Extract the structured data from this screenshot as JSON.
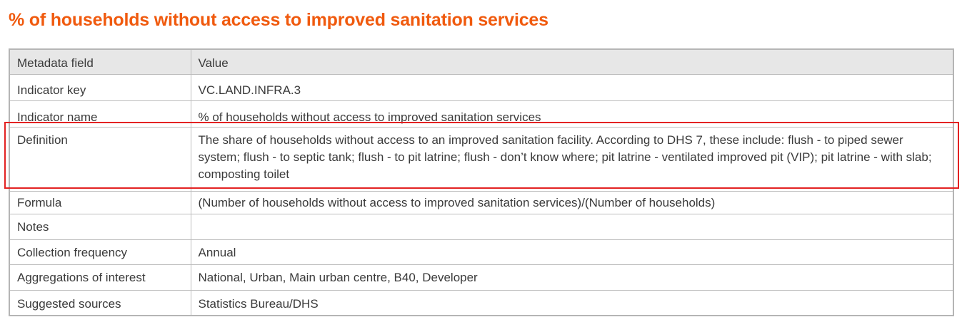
{
  "title": "% of households without access to improved sanitation services",
  "table": {
    "header": {
      "field": "Metadata field",
      "value": "Value"
    },
    "rows": [
      {
        "field": "Indicator key",
        "value": "VC.LAND.INFRA.3"
      },
      {
        "field": "Indicator name",
        "value": "% of households without access to improved sanitation services"
      },
      {
        "field": "Definition",
        "value": "The share of households without access to an improved sanitation facility. According to DHS 7, these include: flush - to piped sewer system; flush - to septic tank; flush - to pit latrine; flush - don’t know where; pit latrine - ventilated improved pit (VIP); pit latrine - with slab; composting toilet"
      },
      {
        "field": "Formula",
        "value": "(Number of households without access to improved sanitation services)/(Number of households)"
      },
      {
        "field": "Notes",
        "value": ""
      },
      {
        "field": "Collection frequency",
        "value": "Annual"
      },
      {
        "field": "Aggregations of interest",
        "value": "National, Urban, Main urban centre, B40, Developer"
      },
      {
        "field": "Suggested sources",
        "value": "Statistics Bureau/DHS"
      }
    ]
  },
  "colors": {
    "title": "#f05a0e",
    "highlight_box": "#e32222",
    "header_background": "#e7e7e7"
  }
}
